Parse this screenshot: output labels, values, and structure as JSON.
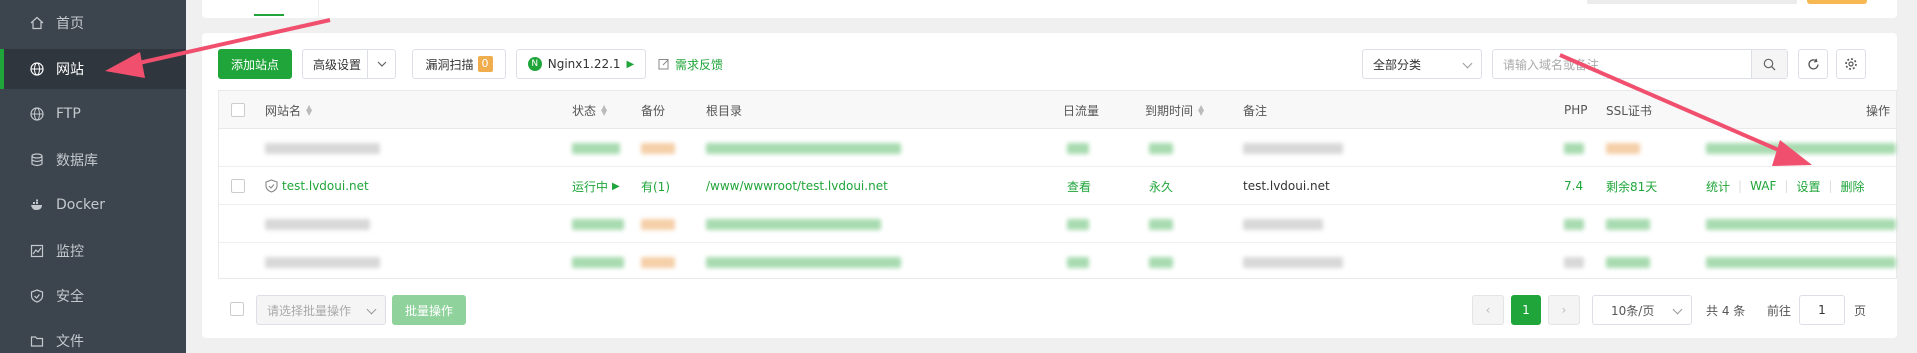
{
  "sidebar": {
    "items": [
      {
        "label": "首页",
        "icon": "home-icon",
        "active": false
      },
      {
        "label": "网站",
        "icon": "globe-icon",
        "active": true
      },
      {
        "label": "FTP",
        "icon": "ftp-globe-icon",
        "active": false
      },
      {
        "label": "数据库",
        "icon": "database-icon",
        "active": false
      },
      {
        "label": "Docker",
        "icon": "docker-icon",
        "active": false
      },
      {
        "label": "监控",
        "icon": "monitor-icon",
        "active": false
      },
      {
        "label": "安全",
        "icon": "shield-icon",
        "active": false
      },
      {
        "label": "文件",
        "icon": "folder-icon",
        "active": false
      }
    ]
  },
  "toolbar": {
    "add_site": "添加站点",
    "advanced": "高级设置",
    "vuln_scan": "漏洞扫描",
    "vuln_count": "0",
    "nginx": "Nginx1.22.1",
    "feedback": "需求反馈",
    "category": "全部分类",
    "search_placeholder": "请输入域名或备注"
  },
  "table": {
    "headers": {
      "name": "网站名",
      "status": "状态",
      "backup": "备份",
      "root": "根目录",
      "traffic": "日流量",
      "expire": "到期时间",
      "remark": "备注",
      "php": "PHP",
      "ssl": "SSL证书",
      "actions": "操作"
    },
    "row": {
      "name": "test.lvdoui.net",
      "status": "运行中",
      "backup": "有(1)",
      "root": "/www/wwwroot/test.lvdoui.net",
      "traffic": "查看",
      "expire": "永久",
      "remark": "test.lvdoui.net",
      "php": "7.4",
      "ssl": "剩余81天",
      "act_stats": "统计",
      "act_waf": "WAF",
      "act_settings": "设置",
      "act_delete": "删除"
    }
  },
  "footer": {
    "batch_placeholder": "请选择批量操作",
    "batch_button": "批量操作",
    "current_page": "1",
    "per_page": "10条/页",
    "total": "共 4 条",
    "goto_label": "前往",
    "goto_value": "1",
    "page_unit": "页"
  },
  "colors": {
    "accent": "#20a53a",
    "annotation_arrow": "#f0506e",
    "sidebar_bg": "#3c444d"
  }
}
